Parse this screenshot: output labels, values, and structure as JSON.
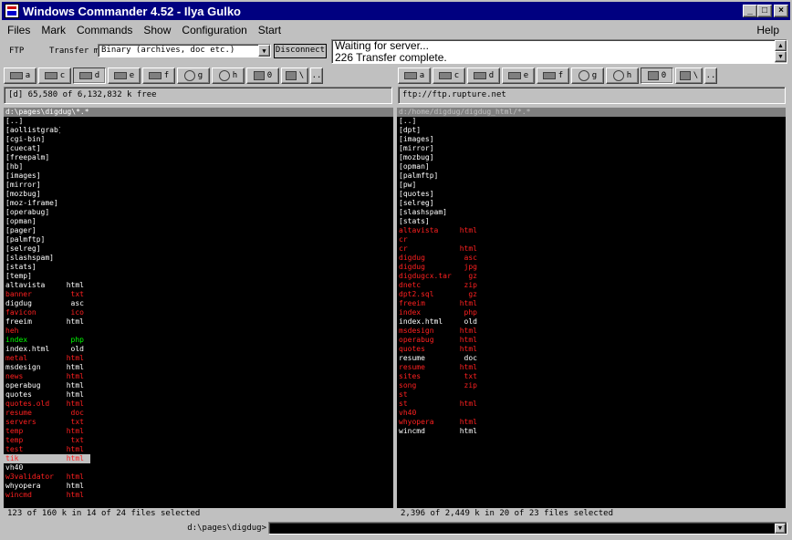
{
  "window": {
    "title": "Windows Commander 4.52 - Ilya Gulko",
    "min_glyph": "_",
    "max_glyph": "□",
    "close_glyph": "×"
  },
  "menu": {
    "items": [
      "Files",
      "Mark",
      "Commands",
      "Show",
      "Configuration",
      "Start"
    ],
    "help": "Help"
  },
  "ftp": {
    "label": "FTP",
    "transfer_mode_label": "Transfer mode",
    "transfer_mode_value": "Binary (archives, doc etc.)",
    "disconnect_label": "Disconnect",
    "log_line1": "Waiting for server...",
    "log_line2": "226 Transfer complete."
  },
  "drives": {
    "left": [
      "a",
      "c",
      "d",
      "e",
      "f",
      "g",
      "h",
      "0",
      "\\",
      ".."
    ],
    "right": [
      "a",
      "c",
      "d",
      "e",
      "f",
      "g",
      "h",
      "0",
      "\\",
      ".."
    ],
    "left_active": "d",
    "right_active": "0"
  },
  "left_panel": {
    "info": "[d]  65,580 of 6,132,832 k free",
    "path": "d:\\pages\\digdug\\*.*",
    "status": "123 of 160 k in 14 of 24 files selected",
    "files": [
      {
        "name": "[..]",
        "ext": "",
        "color": "white"
      },
      {
        "name": "[aollistgrab]",
        "ext": "",
        "color": "white"
      },
      {
        "name": "[cgi-bin]",
        "ext": "",
        "color": "white"
      },
      {
        "name": "[cuecat]",
        "ext": "",
        "color": "white"
      },
      {
        "name": "[freepalm]",
        "ext": "",
        "color": "white"
      },
      {
        "name": "[hb]",
        "ext": "",
        "color": "white"
      },
      {
        "name": "[images]",
        "ext": "",
        "color": "white"
      },
      {
        "name": "[mirror]",
        "ext": "",
        "color": "white"
      },
      {
        "name": "[mozbug]",
        "ext": "",
        "color": "white"
      },
      {
        "name": "[moz-iframe]",
        "ext": "",
        "color": "white"
      },
      {
        "name": "[operabug]",
        "ext": "",
        "color": "white"
      },
      {
        "name": "[opman]",
        "ext": "",
        "color": "white"
      },
      {
        "name": "[pager]",
        "ext": "",
        "color": "white"
      },
      {
        "name": "[palmftp]",
        "ext": "",
        "color": "white"
      },
      {
        "name": "[selreg]",
        "ext": "",
        "color": "white"
      },
      {
        "name": "[slashspam]",
        "ext": "",
        "color": "white"
      },
      {
        "name": "[stats]",
        "ext": "",
        "color": "white"
      },
      {
        "name": "[temp]",
        "ext": "",
        "color": "white"
      },
      {
        "name": "altavista",
        "ext": "html",
        "color": "white"
      },
      {
        "name": "banner",
        "ext": "txt",
        "color": "red"
      },
      {
        "name": "digdug",
        "ext": "asc",
        "color": "white"
      },
      {
        "name": "favicon",
        "ext": "ico",
        "color": "red"
      },
      {
        "name": "freeim",
        "ext": "html",
        "color": "white"
      },
      {
        "name": "heh",
        "ext": "",
        "color": "red"
      },
      {
        "name": "index",
        "ext": "php",
        "color": "green"
      },
      {
        "name": "index.html",
        "ext": "old",
        "color": "white"
      },
      {
        "name": "metal",
        "ext": "html",
        "color": "red"
      },
      {
        "name": "msdesign",
        "ext": "html",
        "color": "white"
      },
      {
        "name": "news",
        "ext": "html",
        "color": "red"
      },
      {
        "name": "operabug",
        "ext": "html",
        "color": "white"
      },
      {
        "name": "quotes",
        "ext": "html",
        "color": "white"
      },
      {
        "name": "quotes.old",
        "ext": "html",
        "color": "red"
      },
      {
        "name": "resume",
        "ext": "doc",
        "color": "red"
      },
      {
        "name": "servers",
        "ext": "txt",
        "color": "red"
      },
      {
        "name": "temp",
        "ext": "html",
        "color": "red"
      },
      {
        "name": "temp",
        "ext": "txt",
        "color": "red"
      },
      {
        "name": "test",
        "ext": "html",
        "color": "red"
      },
      {
        "name": "tik",
        "ext": "html",
        "color": "red",
        "cursor": true
      },
      {
        "name": "vh40",
        "ext": "",
        "color": "white"
      },
      {
        "name": "w3validator",
        "ext": "html",
        "color": "red"
      },
      {
        "name": "whyopera",
        "ext": "html",
        "color": "white"
      },
      {
        "name": "wincmd",
        "ext": "html",
        "color": "red"
      }
    ]
  },
  "right_panel": {
    "info": "ftp://ftp.rupture.net",
    "path": "d:/home/digdug/digdug_html/*.*",
    "status": "2,396 of 2,449 k in 20 of 23 files selected",
    "files": [
      {
        "name": "[..]",
        "ext": "",
        "color": "white"
      },
      {
        "name": "[dpt]",
        "ext": "",
        "color": "white"
      },
      {
        "name": "[images]",
        "ext": "",
        "color": "white"
      },
      {
        "name": "[mirror]",
        "ext": "",
        "color": "white"
      },
      {
        "name": "[mozbug]",
        "ext": "",
        "color": "white"
      },
      {
        "name": "[opman]",
        "ext": "",
        "color": "white"
      },
      {
        "name": "[palmftp]",
        "ext": "",
        "color": "white"
      },
      {
        "name": "[pw]",
        "ext": "",
        "color": "white"
      },
      {
        "name": "[quotes]",
        "ext": "",
        "color": "white"
      },
      {
        "name": "[selreg]",
        "ext": "",
        "color": "white"
      },
      {
        "name": "[slashspam]",
        "ext": "",
        "color": "white"
      },
      {
        "name": "[stats]",
        "ext": "",
        "color": "white"
      },
      {
        "name": "altavista",
        "ext": "html",
        "color": "red"
      },
      {
        "name": "cr",
        "ext": "",
        "color": "red"
      },
      {
        "name": "cr",
        "ext": "html",
        "color": "red"
      },
      {
        "name": "digdug",
        "ext": "asc",
        "color": "red"
      },
      {
        "name": "digdug",
        "ext": "jpg",
        "color": "red"
      },
      {
        "name": "digdugcx.tar",
        "ext": "gz",
        "color": "red"
      },
      {
        "name": "dnetc",
        "ext": "zip",
        "color": "red"
      },
      {
        "name": "dpt2.sql",
        "ext": "gz",
        "color": "red"
      },
      {
        "name": "freeim",
        "ext": "html",
        "color": "red"
      },
      {
        "name": "index",
        "ext": "php",
        "color": "red"
      },
      {
        "name": "index.html",
        "ext": "old",
        "color": "white"
      },
      {
        "name": "msdesign",
        "ext": "html",
        "color": "red"
      },
      {
        "name": "operabug",
        "ext": "html",
        "color": "red"
      },
      {
        "name": "quotes",
        "ext": "html",
        "color": "red"
      },
      {
        "name": "resume",
        "ext": "doc",
        "color": "white"
      },
      {
        "name": "resume",
        "ext": "html",
        "color": "red"
      },
      {
        "name": "sites",
        "ext": "txt",
        "color": "red"
      },
      {
        "name": "song",
        "ext": "zip",
        "color": "red"
      },
      {
        "name": "st",
        "ext": "",
        "color": "red"
      },
      {
        "name": "st",
        "ext": "html",
        "color": "red"
      },
      {
        "name": "vh40",
        "ext": "",
        "color": "red"
      },
      {
        "name": "whyopera",
        "ext": "html",
        "color": "red"
      },
      {
        "name": "wincmd",
        "ext": "html",
        "color": "white"
      }
    ]
  },
  "command_line": {
    "path": "d:\\pages\\digdug>",
    "value": ""
  },
  "colors": {
    "titlebar": "#000080",
    "panel_bg": "#000000",
    "file_normal": "#ffffff",
    "file_selected": "#ff2020",
    "file_exec": "#00ff00"
  }
}
